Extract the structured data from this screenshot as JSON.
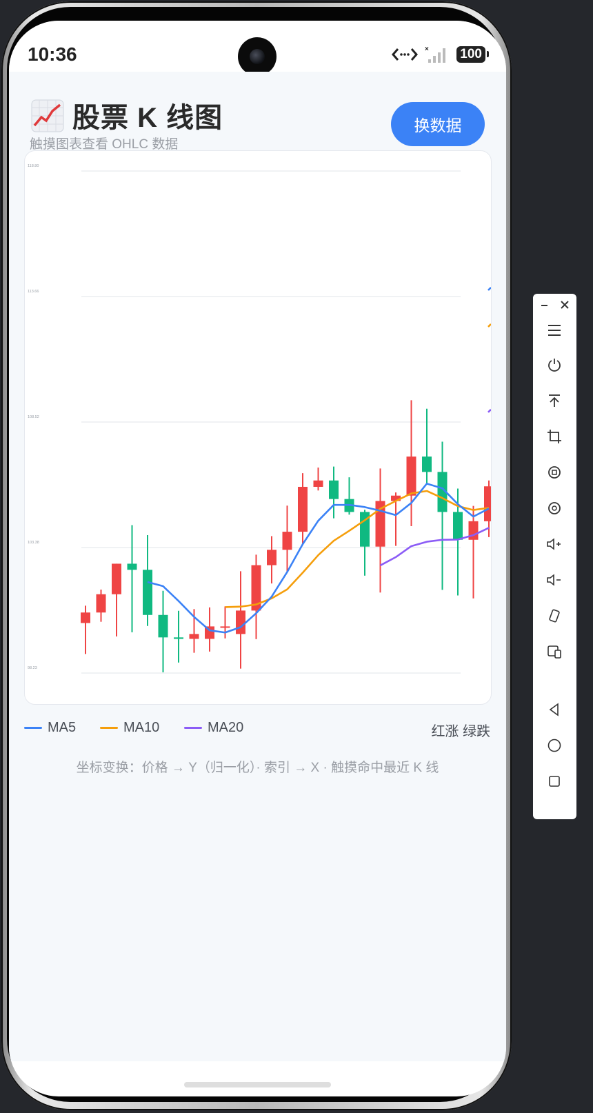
{
  "status_bar": {
    "time": "10:36",
    "battery": "100",
    "icons": [
      "data-transfer-icon",
      "no-sim-icon",
      "signal-icon",
      "battery-icon"
    ]
  },
  "header": {
    "icon": "chart-increasing-icon",
    "title": "股票 K 线图",
    "subtitle": "触摸图表查看 OHLC 数据",
    "swap_button": "换数据"
  },
  "legend": {
    "items": [
      {
        "label": "MA5",
        "color": "#3b82f6"
      },
      {
        "label": "MA10",
        "color": "#f59e0b"
      },
      {
        "label": "MA20",
        "color": "#8b5cf6"
      }
    ],
    "note": "红涨 绿跌"
  },
  "hint": "坐标变换：价格 → Y（归一化）· 索引 → X · 触摸命中最近 K 线",
  "colors": {
    "up": "#ef4444",
    "down": "#10b981",
    "accent": "#3b82f6"
  },
  "chart_data": {
    "type": "candlestick",
    "y_ticks": [
      "118.80",
      "113.66",
      "108.52",
      "103.38",
      "98.23"
    ],
    "ylim": [
      98.23,
      118.8
    ],
    "grid": true,
    "candles": [
      {
        "o": 100.28,
        "h": 100.99,
        "l": 99.01,
        "c": 100.71
      },
      {
        "o": 100.71,
        "h": 101.65,
        "l": 100.33,
        "c": 101.46
      },
      {
        "o": 101.46,
        "h": 102.71,
        "l": 99.73,
        "c": 102.71
      },
      {
        "o": 102.71,
        "h": 104.29,
        "l": 99.9,
        "c": 102.46
      },
      {
        "o": 102.46,
        "h": 103.88,
        "l": 100.16,
        "c": 100.61
      },
      {
        "o": 100.61,
        "h": 101.6,
        "l": 98.26,
        "c": 99.69
      },
      {
        "o": 99.69,
        "h": 100.78,
        "l": 98.66,
        "c": 99.63
      },
      {
        "o": 99.63,
        "h": 100.85,
        "l": 99.06,
        "c": 99.83
      },
      {
        "o": 99.63,
        "h": 100.92,
        "l": 99.11,
        "c": 100.14
      },
      {
        "o": 100.14,
        "h": 100.96,
        "l": 99.65,
        "c": 100.14
      },
      {
        "o": 99.83,
        "h": 102.4,
        "l": 98.41,
        "c": 100.79
      },
      {
        "o": 100.79,
        "h": 103.08,
        "l": 99.62,
        "c": 102.65
      },
      {
        "o": 102.65,
        "h": 103.84,
        "l": 101.9,
        "c": 103.28
      },
      {
        "o": 103.28,
        "h": 105.09,
        "l": 102.34,
        "c": 104.02
      },
      {
        "o": 104.02,
        "h": 106.42,
        "l": 103.51,
        "c": 105.86
      },
      {
        "o": 105.86,
        "h": 106.65,
        "l": 105.71,
        "c": 106.12
      },
      {
        "o": 106.12,
        "h": 106.69,
        "l": 104.57,
        "c": 105.36
      },
      {
        "o": 105.36,
        "h": 106.25,
        "l": 104.72,
        "c": 104.83
      },
      {
        "o": 104.83,
        "h": 104.92,
        "l": 102.22,
        "c": 103.41
      },
      {
        "o": 103.41,
        "h": 106.61,
        "l": 101.53,
        "c": 105.28
      },
      {
        "o": 105.28,
        "h": 105.63,
        "l": 103.44,
        "c": 105.5
      },
      {
        "o": 105.5,
        "h": 109.41,
        "l": 104.25,
        "c": 107.1
      },
      {
        "o": 107.1,
        "h": 109.06,
        "l": 106.0,
        "c": 106.47
      },
      {
        "o": 106.47,
        "h": 107.71,
        "l": 101.64,
        "c": 104.83
      },
      {
        "o": 104.83,
        "h": 105.79,
        "l": 101.41,
        "c": 103.69
      },
      {
        "o": 103.69,
        "h": 105.08,
        "l": 101.29,
        "c": 104.45
      },
      {
        "o": 104.45,
        "h": 106.12,
        "l": 103.8,
        "c": 105.88
      }
    ],
    "ma5": [
      null,
      null,
      null,
      null,
      101.96,
      101.79,
      101.18,
      100.53,
      99.98,
      99.89,
      100.11,
      100.68,
      101.36,
      102.37,
      103.51,
      104.47,
      105.12,
      105.12,
      105.03,
      104.88,
      104.7,
      105.2,
      105.99,
      105.8,
      105.15,
      104.64,
      104.97
    ],
    "ma10": [
      null,
      null,
      null,
      null,
      null,
      null,
      null,
      null,
      null,
      100.93,
      100.95,
      101.04,
      101.29,
      101.66,
      102.34,
      103.06,
      103.65,
      104.06,
      104.49,
      104.96,
      105.28,
      105.59,
      105.69,
      105.4,
      105.07,
      104.91,
      105.0
    ],
    "ma20": [
      null,
      null,
      null,
      null,
      null,
      null,
      null,
      null,
      null,
      null,
      null,
      null,
      null,
      null,
      null,
      null,
      null,
      null,
      null,
      102.64,
      102.98,
      103.43,
      103.61,
      103.69,
      103.7,
      103.88,
      104.18
    ],
    "ma5_tail": 114.0,
    "ma10_tail": 112.5,
    "ma20_tail": 109.0
  }
}
